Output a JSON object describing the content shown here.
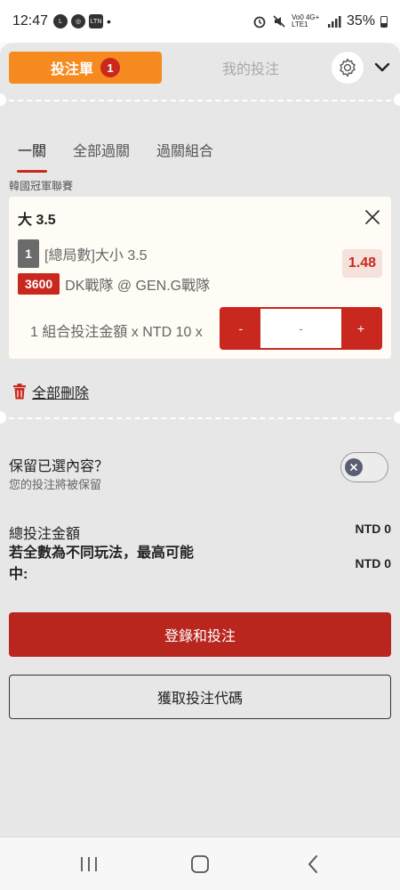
{
  "status_bar": {
    "time": "12:47",
    "left_icons": [
      "LINE",
      "WiFi",
      "LTN"
    ],
    "dot": "•",
    "network_label": "Vo0 4G+ LTE1",
    "battery": "35%"
  },
  "header": {
    "betslip_label": "投注單",
    "betslip_count": "1",
    "my_bets_label": "我的投注",
    "settings_icon": "gear-icon",
    "collapse_icon": "chevron-down-icon"
  },
  "subtabs": [
    {
      "label": "一關",
      "active": true
    },
    {
      "label": "全部過關",
      "active": false
    },
    {
      "label": "過關組合",
      "active": false
    }
  ],
  "league": "韓國冠軍聯賽",
  "bet": {
    "title": "大 3.5",
    "leg_number": "1",
    "market": "[總局數]大小 3.5",
    "match_id": "3600",
    "match": "DK戰隊 @ GEN.G戰隊",
    "odds": "1.48",
    "stake_label": "1 組合投注金額 x NTD 10 x",
    "stepper_minus": "-",
    "stepper_value": "-",
    "stepper_plus": "+"
  },
  "delete_all_label": "全部刪除",
  "keep": {
    "title": "保留已選內容？",
    "subtitle": "您的投注將被保留",
    "enabled": false
  },
  "summary": {
    "total_label": "總投注金額",
    "total_value": "NTD 0",
    "max_win_label": "若全數為不同玩法，最高可能中:",
    "max_win_value": "NTD 0"
  },
  "actions": {
    "login_label": "登錄和投注",
    "code_label": "獲取投注代碼"
  },
  "colors": {
    "accent_orange": "#f68a1f",
    "accent_red": "#c8281e",
    "sheet_bg": "#e7e7e7",
    "card_bg": "#fffcf5"
  }
}
